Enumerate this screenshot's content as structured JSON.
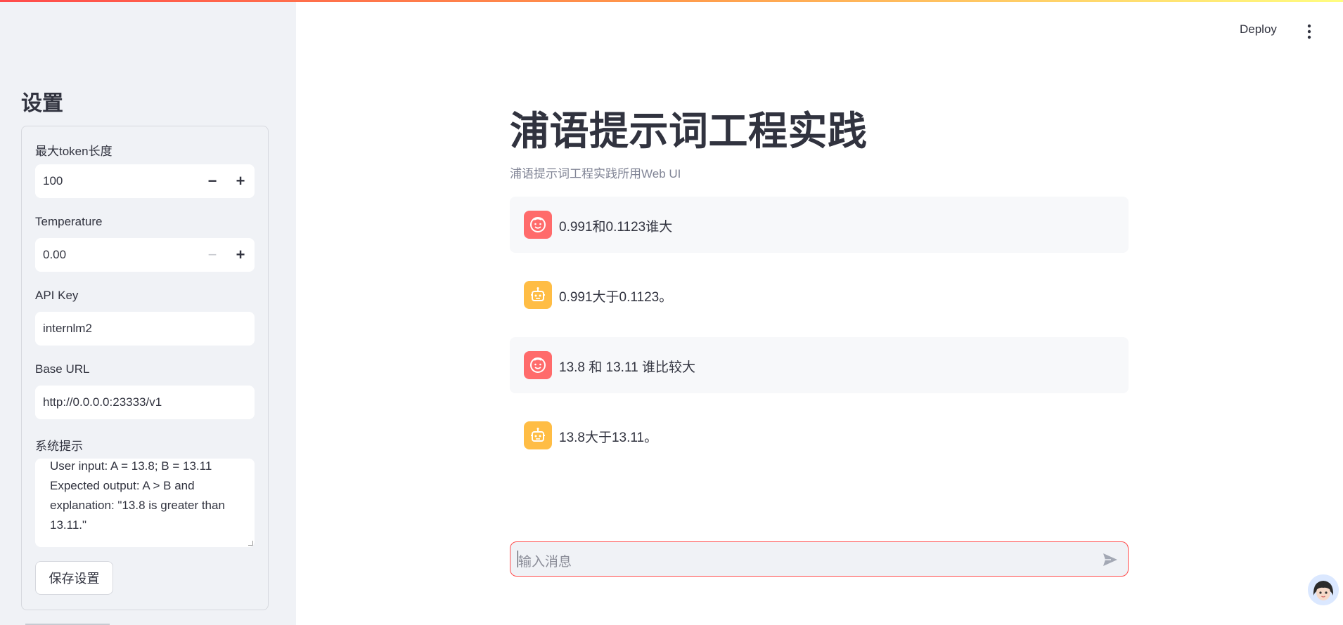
{
  "sidebar": {
    "title": "设置",
    "max_tokens": {
      "label": "最大token长度",
      "value": "100"
    },
    "temperature": {
      "label": "Temperature",
      "value": "0.00"
    },
    "api_key": {
      "label": "API Key",
      "value": "internlm2"
    },
    "base_url": {
      "label": "Base URL",
      "value": "http://0.0.0.0:23333/v1"
    },
    "system_prompt": {
      "label": "系统提示",
      "visible_text": "User input: A = 13.8; B = 13.11\nExpected output: A > B and explanation: \"13.8 is greater than 13.11.\""
    },
    "save_label": "保存设置",
    "stepper_minus": "−",
    "stepper_plus": "+"
  },
  "header": {
    "deploy_label": "Deploy"
  },
  "main": {
    "title": "浦语提示词工程实践",
    "caption": "浦语提示词工程实践所用Web UI",
    "messages": [
      {
        "role": "user",
        "text": "0.991和0.1123谁大"
      },
      {
        "role": "assistant",
        "text": "0.991大于0.1123。"
      },
      {
        "role": "user",
        "text": "13.8 和 13.11 谁比较大"
      },
      {
        "role": "assistant",
        "text": "13.8大于13.11。"
      }
    ],
    "chat_input_placeholder": "输入消息"
  },
  "colors": {
    "accent": "#ff4b4b",
    "user_avatar": "#ff6b6b",
    "assistant_avatar": "#ffbd45",
    "sidebar_bg": "#f0f2f6"
  },
  "icons": {
    "user_avatar": "smiley-face-icon",
    "assistant_avatar": "robot-icon",
    "menu": "vertical-ellipsis-icon",
    "send": "send-arrow-icon"
  }
}
